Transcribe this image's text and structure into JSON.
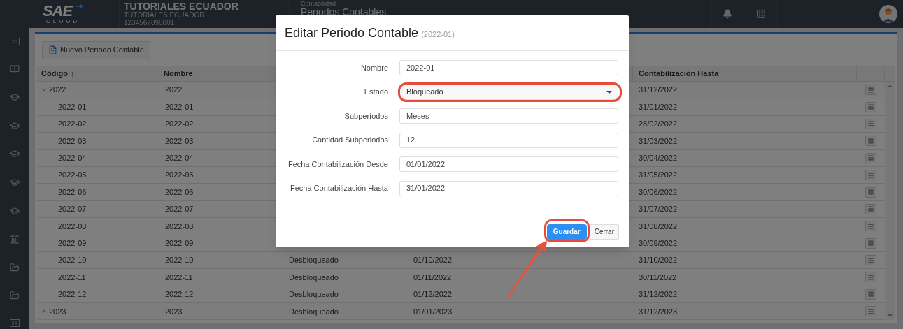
{
  "header": {
    "logo": {
      "text": "SAE",
      "subtext": "CLOUD"
    },
    "company": {
      "name": "TUTORIALES ECUADOR",
      "subname": "TUTORIALES ECUADOR",
      "ruc": "1234567890001"
    },
    "breadcrumb": {
      "module": "Contabilidad",
      "page": "Periodos Contables"
    }
  },
  "sidebar": {
    "items": [
      {
        "kind": "cc"
      },
      {
        "kind": "book"
      },
      {
        "kind": "cap"
      },
      {
        "kind": "cap"
      },
      {
        "kind": "cap"
      },
      {
        "kind": "cap"
      },
      {
        "kind": "cap"
      },
      {
        "kind": "bank"
      },
      {
        "kind": "folder"
      },
      {
        "kind": "folder"
      },
      {
        "kind": "cc"
      }
    ]
  },
  "toolbar": {
    "new_button": "Nuevo Periodo Contable"
  },
  "table": {
    "columns": [
      {
        "label": "Código",
        "sort_mark": "↑"
      },
      {
        "label": "Nombre"
      },
      {
        "label": "Contabilización Hasta"
      }
    ],
    "rows": [
      {
        "kind": "group",
        "expanded": true,
        "codigo": "2022",
        "nombre": "2022",
        "hasta": "31/12/2022"
      },
      {
        "kind": "child",
        "codigo": "2022-01",
        "nombre": "2022-01",
        "hasta": "31/01/2022"
      },
      {
        "kind": "child",
        "codigo": "2022-02",
        "nombre": "2022-02",
        "hasta": "28/02/2022"
      },
      {
        "kind": "child",
        "codigo": "2022-03",
        "nombre": "2022-03",
        "hasta": "31/03/2022"
      },
      {
        "kind": "child",
        "codigo": "2022-04",
        "nombre": "2022-04",
        "hasta": "30/04/2022"
      },
      {
        "kind": "child",
        "codigo": "2022-05",
        "nombre": "2022-05",
        "hasta": "31/05/2022"
      },
      {
        "kind": "child",
        "codigo": "2022-06",
        "nombre": "2022-06",
        "hasta": "30/06/2022"
      },
      {
        "kind": "child",
        "codigo": "2022-07",
        "nombre": "2022-07",
        "hasta": "31/07/2022"
      },
      {
        "kind": "child",
        "codigo": "2022-08",
        "nombre": "2022-08",
        "hasta": "31/08/2022"
      },
      {
        "kind": "child",
        "codigo": "2022-09",
        "nombre": "2022-09",
        "hasta": "30/09/2022"
      },
      {
        "kind": "child",
        "codigo": "2022-10",
        "nombre": "2022-10",
        "estado": "Desbloqueado",
        "desde": "01/10/2022",
        "hasta": "31/10/2022"
      },
      {
        "kind": "child",
        "codigo": "2022-11",
        "nombre": "2022-11",
        "estado": "Desbloqueado",
        "desde": "01/11/2022",
        "hasta": "30/11/2022"
      },
      {
        "kind": "child",
        "codigo": "2022-12",
        "nombre": "2022-12",
        "estado": "Desbloqueado",
        "desde": "01/12/2022",
        "hasta": "31/12/2022"
      },
      {
        "kind": "group",
        "expanded": false,
        "codigo": "2023",
        "nombre": "2023",
        "estado": "Desbloqueado",
        "desde": "01/01/2023",
        "hasta": "31/12/2023"
      }
    ]
  },
  "modal": {
    "title": "Editar Periodo Contable",
    "subtitle": "(2022-01)",
    "fields": [
      {
        "kind": "text",
        "label": "Nombre",
        "value": "2022-01",
        "highlighted": false
      },
      {
        "kind": "select",
        "label": "Estado",
        "value": "Bloqueado",
        "highlighted": true
      },
      {
        "kind": "text",
        "label": "Subperíodos",
        "value": "Meses",
        "highlighted": false
      },
      {
        "kind": "text",
        "label": "Cantidad Subperiodos",
        "value": "12",
        "highlighted": false
      },
      {
        "kind": "text",
        "label": "Fecha Contabilización Desde",
        "value": "01/01/2022",
        "highlighted": false
      },
      {
        "kind": "text",
        "label": "Fecha Contabilización Hasta",
        "value": "31/01/2022",
        "highlighted": false
      }
    ],
    "buttons": [
      {
        "kind": "primary",
        "label": "Guardar",
        "highlighted": true
      },
      {
        "kind": "default",
        "label": "Cerrar",
        "highlighted": false
      }
    ]
  }
}
